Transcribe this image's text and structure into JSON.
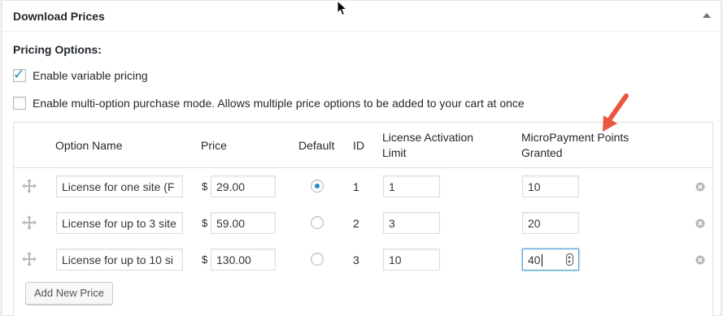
{
  "panel": {
    "title": "Download Prices"
  },
  "pricing": {
    "section_label": "Pricing Options:",
    "variable_pricing_label": "Enable variable pricing",
    "variable_pricing_checked": true,
    "multi_option_label": "Enable multi-option purchase mode. Allows multiple price options to be added to your cart at once",
    "multi_option_checked": false
  },
  "table": {
    "headers": {
      "option_name": "Option Name",
      "price": "Price",
      "default": "Default",
      "id": "ID",
      "license_limit_1": "License Activation",
      "license_limit_2": "Limit",
      "points_1": "MicroPayment Points",
      "points_2": "Granted"
    },
    "currency_symbol": "$",
    "rows": [
      {
        "name": "License for one site  (F",
        "price": "29.00",
        "default": true,
        "id": "1",
        "limit": "1",
        "points": "10"
      },
      {
        "name": "License for up to 3  site",
        "price": "59.00",
        "default": false,
        "id": "2",
        "limit": "3",
        "points": "20"
      },
      {
        "name": "License for up to 10  si",
        "price": "130.00",
        "default": false,
        "id": "3",
        "limit": "10",
        "points": "40"
      }
    ],
    "add_button_label": "Add New Price"
  },
  "colors": {
    "accent": "#1e8cbe",
    "annotation_arrow": "#e9573f"
  }
}
